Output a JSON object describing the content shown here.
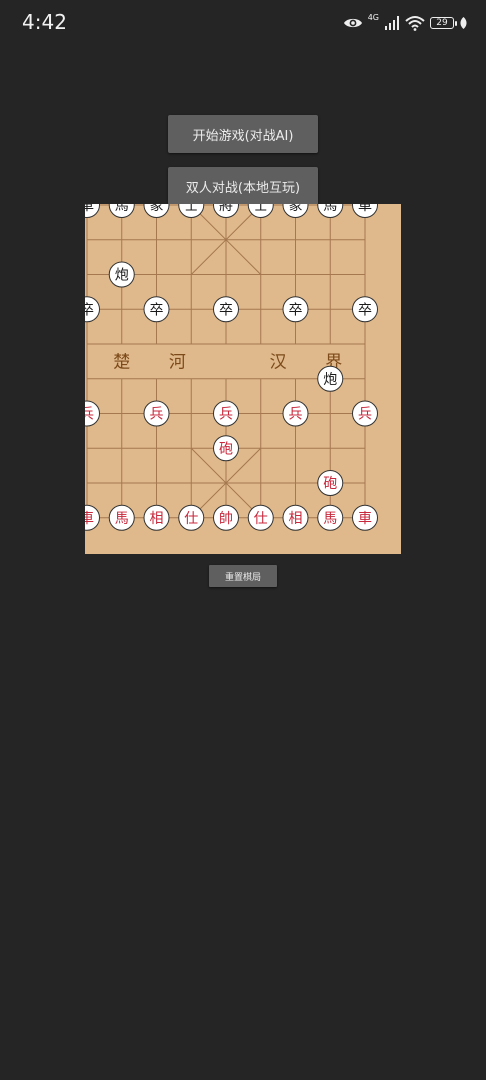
{
  "status_bar": {
    "time": "4:42",
    "network_label": "4G",
    "battery_level": "29",
    "icons": [
      "eye-icon",
      "signal-icon",
      "wifi-icon",
      "battery-icon",
      "leaf-icon"
    ]
  },
  "menu": {
    "start_ai_label": "开始游戏(对战AI)",
    "two_player_label": "双人对战(本地互玩)"
  },
  "board": {
    "background_color": "#dfb98b",
    "line_color": "#a57850",
    "river_text_color": "#7d4a1a",
    "river_labels": [
      "楚",
      "河",
      "汉",
      "界"
    ],
    "black_piece_color": "#1a1a1a",
    "red_piece_color": "#c8283c",
    "pieces": [
      {
        "text": "車",
        "side": "black",
        "col": 0,
        "row": 0
      },
      {
        "text": "馬",
        "side": "black",
        "col": 1,
        "row": 0
      },
      {
        "text": "象",
        "side": "black",
        "col": 2,
        "row": 0
      },
      {
        "text": "士",
        "side": "black",
        "col": 3,
        "row": 0
      },
      {
        "text": "將",
        "side": "black",
        "col": 4,
        "row": 0
      },
      {
        "text": "士",
        "side": "black",
        "col": 5,
        "row": 0
      },
      {
        "text": "象",
        "side": "black",
        "col": 6,
        "row": 0
      },
      {
        "text": "馬",
        "side": "black",
        "col": 7,
        "row": 0
      },
      {
        "text": "車",
        "side": "black",
        "col": 8,
        "row": 0
      },
      {
        "text": "炮",
        "side": "black",
        "col": 1,
        "row": 2
      },
      {
        "text": "卒",
        "side": "black",
        "col": 0,
        "row": 3
      },
      {
        "text": "卒",
        "side": "black",
        "col": 2,
        "row": 3
      },
      {
        "text": "卒",
        "side": "black",
        "col": 4,
        "row": 3
      },
      {
        "text": "卒",
        "side": "black",
        "col": 6,
        "row": 3
      },
      {
        "text": "卒",
        "side": "black",
        "col": 8,
        "row": 3
      },
      {
        "text": "炮",
        "side": "black",
        "col": 7,
        "row": 5
      },
      {
        "text": "兵",
        "side": "red",
        "col": 0,
        "row": 6
      },
      {
        "text": "兵",
        "side": "red",
        "col": 2,
        "row": 6
      },
      {
        "text": "兵",
        "side": "red",
        "col": 4,
        "row": 6
      },
      {
        "text": "兵",
        "side": "red",
        "col": 6,
        "row": 6
      },
      {
        "text": "兵",
        "side": "red",
        "col": 8,
        "row": 6
      },
      {
        "text": "砲",
        "side": "red",
        "col": 4,
        "row": 7
      },
      {
        "text": "砲",
        "side": "red",
        "col": 7,
        "row": 8
      },
      {
        "text": "車",
        "side": "red",
        "col": 0,
        "row": 9
      },
      {
        "text": "馬",
        "side": "red",
        "col": 1,
        "row": 9
      },
      {
        "text": "相",
        "side": "red",
        "col": 2,
        "row": 9
      },
      {
        "text": "仕",
        "side": "red",
        "col": 3,
        "row": 9
      },
      {
        "text": "帥",
        "side": "red",
        "col": 4,
        "row": 9
      },
      {
        "text": "仕",
        "side": "red",
        "col": 5,
        "row": 9
      },
      {
        "text": "相",
        "side": "red",
        "col": 6,
        "row": 9
      },
      {
        "text": "馬",
        "side": "red",
        "col": 7,
        "row": 9
      },
      {
        "text": "車",
        "side": "red",
        "col": 8,
        "row": 9
      }
    ]
  },
  "reset_label": "重置棋局"
}
